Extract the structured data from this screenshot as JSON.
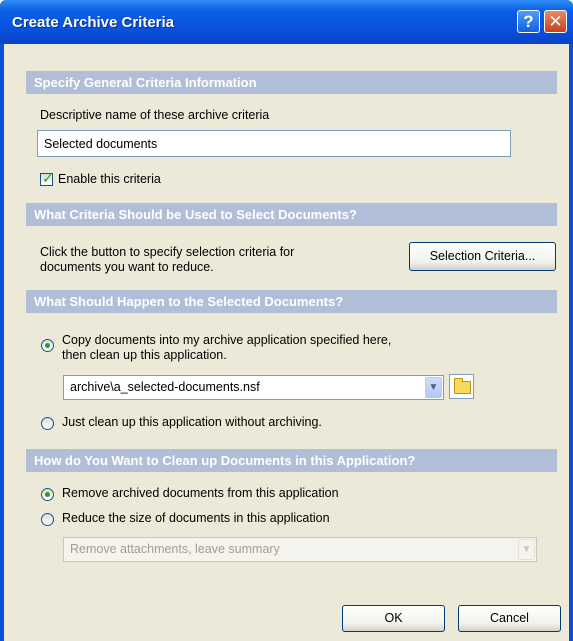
{
  "window": {
    "title": "Create Archive Criteria",
    "help_glyph": "?",
    "close_glyph": "✕"
  },
  "general": {
    "header": "Specify General Criteria Information",
    "name_label": "Descriptive name of these archive criteria",
    "name_value": "Selected documents",
    "enable_label": "Enable this criteria",
    "enable_checked": true
  },
  "selection": {
    "header": "What Criteria Should be Used to Select Documents?",
    "description_line1": "Click the button to specify selection criteria for",
    "description_line2": "documents you want to reduce.",
    "button_label": "Selection Criteria..."
  },
  "happen": {
    "header": "What Should Happen to the Selected Documents?",
    "copy_label_line1": "Copy documents into my archive application specified here,",
    "copy_label_line2": "then clean up this application.",
    "archive_path": "archive\\a_selected-documents.nsf",
    "cleanup_only_label": "Just clean up this application without archiving.",
    "selected_option": "copy"
  },
  "cleanup": {
    "header": "How do You Want to Clean up Documents in this Application?",
    "remove_label": "Remove archived documents from this application",
    "reduce_label": "Reduce the size of documents in this application",
    "reduce_option": "Remove attachments, leave summary",
    "selected_option": "remove"
  },
  "footer": {
    "ok_label": "OK",
    "cancel_label": "Cancel"
  },
  "icons": {
    "help": "help-icon",
    "close": "close-icon",
    "dropdown": "chevron-down-icon",
    "browse": "folder-icon",
    "check": "check-icon"
  },
  "colors": {
    "title_bar": "#0a51d8",
    "section_header": "#b0bed8",
    "client_bg": "#ece9d8",
    "radio_dot": "#21a121"
  }
}
